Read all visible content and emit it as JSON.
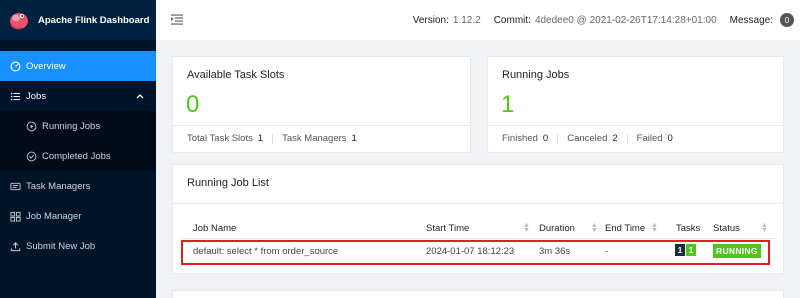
{
  "app": {
    "title": "Apache Flink Dashboard"
  },
  "sidebar": {
    "items": [
      {
        "label": "Overview",
        "icon": "dashboard-icon"
      },
      {
        "label": "Jobs",
        "icon": "list-icon"
      },
      {
        "label": "Running Jobs",
        "icon": "play-circle-icon"
      },
      {
        "label": "Completed Jobs",
        "icon": "check-circle-icon"
      },
      {
        "label": "Task Managers",
        "icon": "task-managers-icon"
      },
      {
        "label": "Job Manager",
        "icon": "cluster-icon"
      },
      {
        "label": "Submit New Job",
        "icon": "upload-icon"
      }
    ]
  },
  "header": {
    "version_label": "Version:",
    "version": "1.12.2",
    "commit_label": "Commit:",
    "commit": "4dedee0 @ 2021-02-26T17:14:28+01:00",
    "message_label": "Message:",
    "message_count": "0"
  },
  "slots": {
    "title": "Available Task Slots",
    "value": "0",
    "total_label": "Total Task Slots",
    "total_value": "1",
    "tm_label": "Task Managers",
    "tm_value": "1"
  },
  "running": {
    "title": "Running Jobs",
    "value": "1",
    "finished_label": "Finished",
    "finished_value": "0",
    "canceled_label": "Canceled",
    "canceled_value": "2",
    "failed_label": "Failed",
    "failed_value": "0"
  },
  "joblist": {
    "title": "Running Job List",
    "columns": [
      "Job Name",
      "Start Time",
      "Duration",
      "End Time",
      "Tasks",
      "Status"
    ],
    "rows": [
      {
        "name": "default: select * from order_source",
        "start": "2024-01-07 18:12:23",
        "duration": "3m 36s",
        "end": "-",
        "tasks_a": "1",
        "tasks_b": "1",
        "status": "RUNNING"
      }
    ]
  },
  "colors": {
    "accent": "#1890ff",
    "success": "#52c41a",
    "sidebar": "#001529",
    "highlight": "#e02020"
  }
}
